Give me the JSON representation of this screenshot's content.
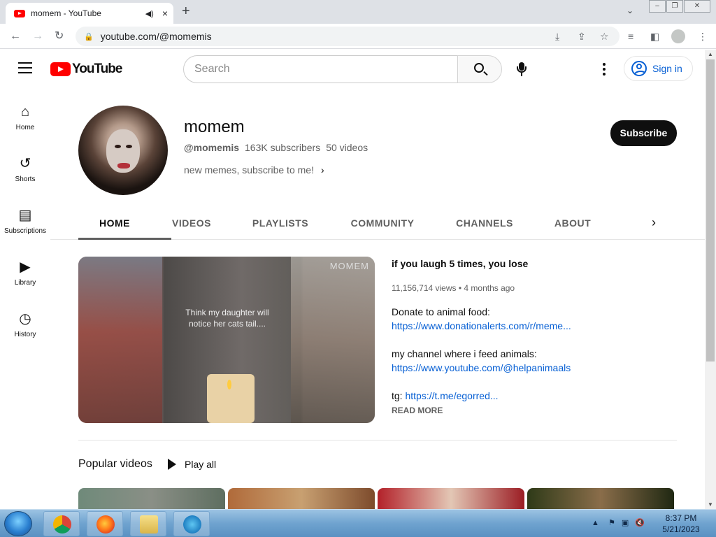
{
  "browser": {
    "tab_title": "momem - YouTube",
    "audio_icon": "speaker-icon",
    "close_tab": "×",
    "new_tab": "+",
    "tab_menu": "⌄",
    "url": "youtube.com/@momemis",
    "window_controls": [
      "minimize",
      "restore",
      "close"
    ]
  },
  "header": {
    "logo_text": "YouTube",
    "search_placeholder": "Search",
    "signin_label": "Sign in"
  },
  "sidebar": {
    "items": [
      {
        "label": "Home",
        "icon": "home-icon",
        "glyph": "⌂"
      },
      {
        "label": "Shorts",
        "icon": "shorts-icon",
        "glyph": "↺"
      },
      {
        "label": "Subscriptions",
        "icon": "subscriptions-icon",
        "glyph": "▤"
      },
      {
        "label": "Library",
        "icon": "library-icon",
        "glyph": "▶"
      },
      {
        "label": "History",
        "icon": "history-icon",
        "glyph": "◷"
      }
    ]
  },
  "channel": {
    "name": "momem",
    "handle": "@momemis",
    "subscribers": "163K subscribers",
    "videos": "50 videos",
    "description": "new memes, subscribe to me!",
    "subscribe_label": "Subscribe"
  },
  "tabs": [
    "HOME",
    "VIDEOS",
    "PLAYLISTS",
    "COMMUNITY",
    "CHANNELS",
    "ABOUT"
  ],
  "featured": {
    "title": "if you laugh 5 times, you lose",
    "views": "11,156,714 views",
    "age": "4 months ago",
    "watermark": "MOMEM",
    "caption_line1": "Think my daughter will",
    "caption_line2": "notice her cats tail....",
    "line1": "Donate to animal food:",
    "link1": "https://www.donationalerts.com/r/meme...",
    "line2": "my channel where i feed animals:",
    "link2": "https://www.youtube.com/@helpanimaals",
    "tg_prefix": "tg: ",
    "link3": "https://t.me/egorred...",
    "read_more": "READ MORE"
  },
  "popular": {
    "title": "Popular videos",
    "play_all": "Play all"
  },
  "taskbar": {
    "time": "8:37 PM",
    "date": "5/21/2023"
  },
  "colors": {
    "youtube_red": "#ff0000",
    "link_blue": "#065fd4",
    "text_dark": "#0f0f0f",
    "text_gray": "#606060"
  }
}
